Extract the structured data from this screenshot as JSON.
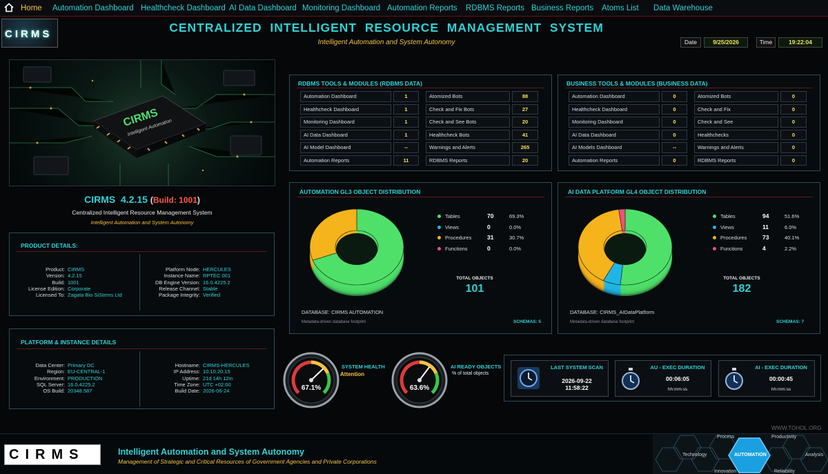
{
  "nav": {
    "items": [
      "Home",
      "Automation Dashboard",
      "Healthcheck Dashboard",
      "AI Data Dashboard",
      "Monitoring Dashboard",
      "Automation Reports",
      "RDBMS Reports",
      "Business Reports",
      "Atoms List",
      "Data Warehouse"
    ],
    "active_index": 0
  },
  "header": {
    "logo": "CIRMS",
    "title": "CENTRALIZED  INTELLIGENT  RESOURCE  MANAGEMENT  SYSTEM",
    "subtitle": "Intelligent Automation and System Autonomy",
    "date_label": "Date",
    "date_value": "9/25/2026",
    "time_label": "Time",
    "time_value": "19:22:04"
  },
  "hero": {
    "chip_text": "CIRMS",
    "chip_sub": "Intelligent Automation",
    "version": "CIRMS  4.2.15",
    "build_paren_open": "(",
    "build": "Build: 1001",
    "build_paren_close": ")",
    "description": "Centralized Intelligent Resource Management System",
    "tagline": "Intelligent Automation and System Autonomy"
  },
  "product_details": {
    "title": "PRODUCT DETAILS:",
    "left": [
      {
        "k": "Product:",
        "v": "CIRMS"
      },
      {
        "k": "Version:",
        "v": "4.2.15"
      },
      {
        "k": "Build:",
        "v": "1001"
      },
      {
        "k": "License Edition:",
        "v": "Corporate"
      },
      {
        "k": "Licensed To:",
        "v": "Zagata Bio SiStems Ltd"
      }
    ],
    "right": [
      {
        "k": "Platform Node:",
        "v": "HERCULES"
      },
      {
        "k": "Instance Name:",
        "v": "RPTEC 001"
      },
      {
        "k": "DB Engine Version:",
        "v": "16.0.4225.2"
      },
      {
        "k": "Release Channel:",
        "v": "Stable"
      },
      {
        "k": "Package Integrity:",
        "v": "Verified"
      }
    ]
  },
  "platform_details": {
    "title": "PLATFORM & INSTANCE DETAILS",
    "left": [
      {
        "k": "Data Center:",
        "v": "Primary DC"
      },
      {
        "k": "Region:",
        "v": "EU-CENTRAL-1"
      },
      {
        "k": "Environment:",
        "v": "PRODUCTION"
      },
      {
        "k": "SQL Server:",
        "v": "16.0.4225.2"
      },
      {
        "k": "OS Build:",
        "v": "20348.587"
      }
    ],
    "right": [
      {
        "k": "Hostname:",
        "v": "CIRMS-HERCULES"
      },
      {
        "k": "IP Address:",
        "v": "10.10.20.15"
      },
      {
        "k": "Uptime:",
        "v": "21d 14h 12m"
      },
      {
        "k": "Time Zone:",
        "v": "UTC +02:00"
      },
      {
        "k": "Build Date:",
        "v": "2026-06-24"
      }
    ]
  },
  "rdbms_tools": {
    "title": "RDBMS TOOLS & MODULES  (RDBMS DATA)",
    "left": [
      {
        "label": "Automation Dashboard",
        "value": "1"
      },
      {
        "label": "Healthcheck Dashboard",
        "value": "1"
      },
      {
        "label": "Monitoring Dashboard",
        "value": "1"
      },
      {
        "label": "AI Data Dashboard",
        "value": "1"
      },
      {
        "label": "AI Model Dashboard",
        "value": "--"
      },
      {
        "label": "Automation Reports",
        "value": "11"
      }
    ],
    "right": [
      {
        "label": "Atomized Bots",
        "value": "88"
      },
      {
        "label": "Check and Fix Bots",
        "value": "27"
      },
      {
        "label": "Check and See Bots",
        "value": "20"
      },
      {
        "label": "Healthcheck Bots",
        "value": "41"
      },
      {
        "label": "Warnings and Alerts",
        "value": "265"
      },
      {
        "label": "RDBMS Reports",
        "value": "20"
      }
    ]
  },
  "business_tools": {
    "title": "BUSINESS TOOLS & MODULES  (BUSINESS DATA)",
    "left": [
      {
        "label": "Automation Dashboard",
        "value": "0"
      },
      {
        "label": "Healthcheck Dashboard",
        "value": "0"
      },
      {
        "label": "Monitoring Dashboard",
        "value": "0"
      },
      {
        "label": "AI Data Dashboard",
        "value": "0"
      },
      {
        "label": "AI Models Dashboard",
        "value": "--"
      },
      {
        "label": "Automation Reports",
        "value": "0"
      }
    ],
    "right": [
      {
        "label": "Atomized Bots",
        "value": "0"
      },
      {
        "label": "Check and Fix",
        "value": "0"
      },
      {
        "label": "Check and See",
        "value": "0"
      },
      {
        "label": "Healthchecks",
        "value": "0"
      },
      {
        "label": "Warnings and Alerts",
        "value": "0"
      },
      {
        "label": "RDBMS Reports",
        "value": "0"
      }
    ]
  },
  "colors": {
    "tables": "#4fe06a",
    "views": "#1fb6e6",
    "procedures": "#f5b31c",
    "functions": "#f0507a",
    "accent": "#2fd1d6",
    "gold": "#f5c242"
  },
  "chart_data": [
    {
      "type": "pie",
      "title": "AUTOMATION GL3 OBJECT DISTRIBUTION",
      "categories": [
        "Tables",
        "Views",
        "Procedures",
        "Functions"
      ],
      "values": [
        70,
        0,
        31,
        0
      ],
      "percents": [
        "69.3%",
        "0.0%",
        "30.7%",
        "0.0%"
      ],
      "total_label": "TOTAL OBJECTS",
      "total": "101",
      "database": "DATABASE: CIRMS AUTOMATION",
      "footnote": "Metadata-driven database footprint",
      "schemas": "SCHEMAS: 5"
    },
    {
      "type": "pie",
      "title": "AI DATA PLATFORM GL4 OBJECT DISTRIBUTION",
      "categories": [
        "Tables",
        "Views",
        "Procedures",
        "Functions"
      ],
      "values": [
        94,
        11,
        73,
        4
      ],
      "percents": [
        "51.6%",
        "6.0%",
        "40.1%",
        "2.2%"
      ],
      "total_label": "TOTAL OBJECTS",
      "total": "182",
      "database": "DATABASE: CIRMS_AIDataPlatform",
      "footnote": "Metadata-driven database footprint",
      "schemas": "SCHEMAS: 7"
    }
  ],
  "gauges": [
    {
      "title": "SYSTEM HEALTH",
      "status": "Attention",
      "value": "67.1%",
      "level": 0.671
    },
    {
      "title": "AI READY OBJECTS",
      "status": "% of total objects",
      "value": "63.6%",
      "level": 0.636
    }
  ],
  "status_cards": [
    {
      "title": "LAST SYSTEM SCAN",
      "value": "2026-09-22",
      "value2": "11:58:22",
      "icon": "clock-icon"
    },
    {
      "title": "AU - EXEC DURATION",
      "value": "00:06:05",
      "value2": "hh:mm:ss",
      "icon": "stopwatch-icon"
    },
    {
      "title": "AI - EXEC DURATION",
      "value": "00:00:45",
      "value2": "hh:mm:ss",
      "icon": "stopwatch-icon"
    }
  ],
  "watermark": "WWW.TOHOL.ORG",
  "footer": {
    "logo": "CIRMS",
    "title": "Intelligent Automation and System Autonomy",
    "subtitle": "Management of Strategic and Critical Resources of Government Agencies and Private Corporations",
    "hex_center": "AUTOMATION",
    "hex_labels": [
      "Process",
      "Productivity",
      "Technology",
      "Analysis",
      "Innovation",
      "Reliability"
    ]
  }
}
